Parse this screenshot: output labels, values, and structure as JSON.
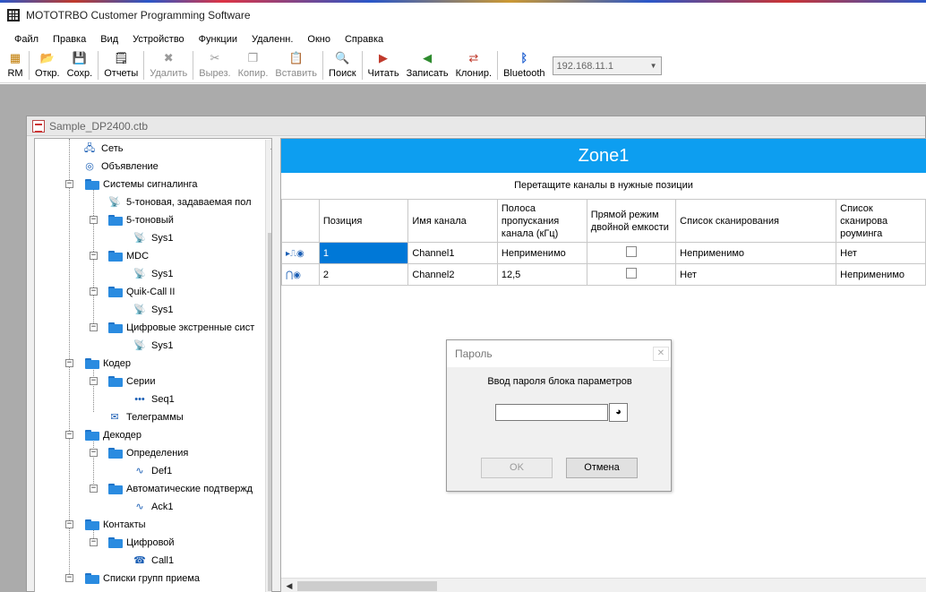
{
  "app": {
    "title": "MOTOTRBO Customer Programming Software"
  },
  "menu": [
    "Файл",
    "Правка",
    "Вид",
    "Устройство",
    "Функции",
    "Удаленн.",
    "Окно",
    "Справка"
  ],
  "toolbar": {
    "rm": "RM",
    "open": "Откр.",
    "save": "Сохр.",
    "reports": "Отчеты",
    "delete": "Удалить",
    "cut": "Вырез.",
    "copy": "Копир.",
    "paste": "Вставить",
    "search": "Поиск",
    "read": "Читать",
    "write": "Записать",
    "clone": "Клонир.",
    "bluetooth": "Bluetooth",
    "ip": "192.168.11.1"
  },
  "document": {
    "title": "Sample_DP2400.ctb"
  },
  "tree": {
    "network": "Сеть",
    "announcement": "Объявление",
    "signaling": "Системы сигналинга",
    "five_tone_user": "5-тоновая, задаваемая пол",
    "five_tone": "5-тоновый",
    "sys1_a": "Sys1",
    "mdc": "MDC",
    "sys1_b": "Sys1",
    "quik_call": "Quik-Call II",
    "sys1_c": "Sys1",
    "digital_emergency": "Цифровые экстренные сист",
    "sys1_d": "Sys1",
    "encoder": "Кодер",
    "series": "Серии",
    "seq1": "Seq1",
    "telegrams": "Телеграммы",
    "decoder": "Декодер",
    "definitions": "Определения",
    "def1": "Def1",
    "auto_ack": "Автоматические подтвержд",
    "ack1": "Ack1",
    "contacts": "Контакты",
    "digital": "Цифровой",
    "call1": "Call1",
    "rx_groups": "Списки групп приема"
  },
  "zone": {
    "title": "Zone1",
    "hint": "Перетащите каналы в нужные позиции",
    "columns": [
      "Позиция",
      "Имя канала",
      "Полоса пропускания канала (кГц)",
      "Прямой режим двойной емкости",
      "Список сканирования",
      "Список сканирова роуминга"
    ],
    "rows": [
      {
        "position": "1",
        "name": "Channel1",
        "bandwidth": "Неприменимо",
        "scan": "Неприменимо",
        "roam": "Нет"
      },
      {
        "position": "2",
        "name": "Channel2",
        "bandwidth": "12,5",
        "scan": "Нет",
        "roam": "Неприменимо"
      }
    ]
  },
  "dialog": {
    "title": "Пароль",
    "prompt": "Ввод пароля блока параметров",
    "password_value": "",
    "ok": "OK",
    "cancel": "Отмена"
  },
  "colors": {
    "zone_header": "#0d9ef0",
    "selection": "#0078d7"
  }
}
